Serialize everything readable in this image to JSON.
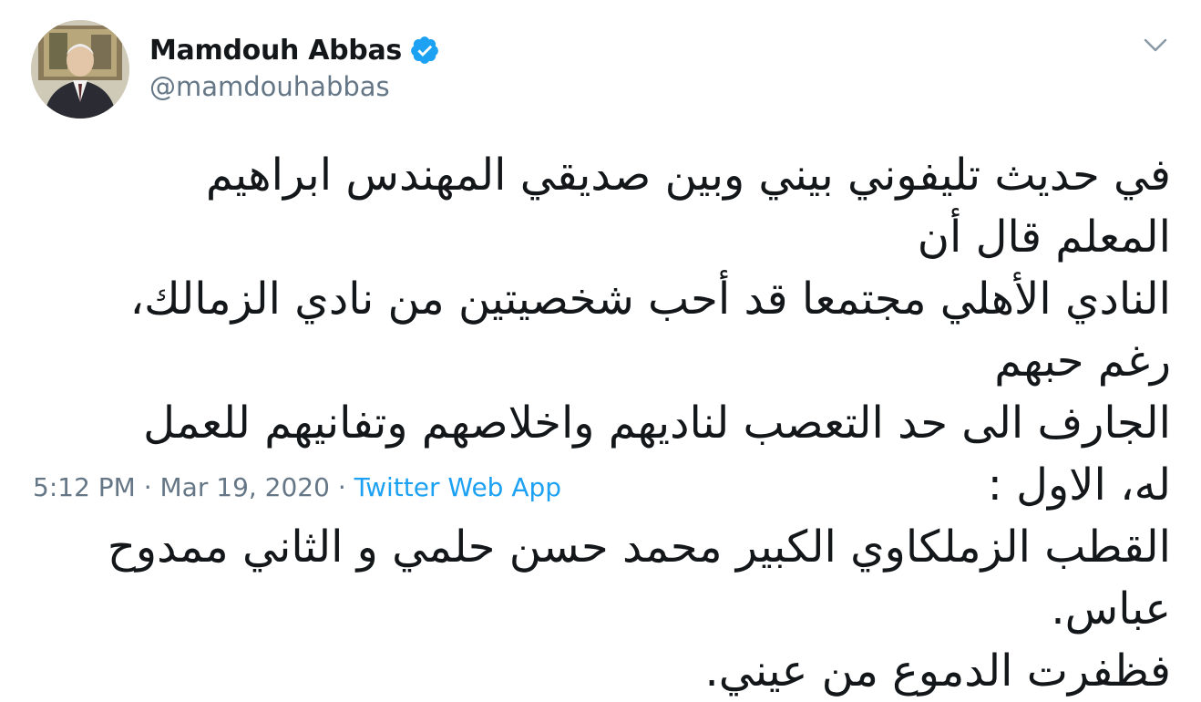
{
  "tweet": {
    "author": {
      "display_name": "Mamdouh Abbas",
      "handle": "@mamdouhabbas",
      "verified": true,
      "avatar_icon": "user-avatar"
    },
    "menu_icon": "chevron-down-icon",
    "text": "في حديث تليفوني بيني وبين صديقي المهندس ابراهيم المعلم قال أن\nالنادي الأهلي مجتمعا قد أحب شخصيتين من نادي الزمالك، رغم حبهم\nالجارف الى حد التعصب لناديهم واخلاصهم وتفانيهم للعمل له، الاول :\nالقطب الزملكاوي الكبير محمد حسن حلمي و الثاني ممدوح عباس.\nفظفرت الدموع من عيني.",
    "footer": {
      "time": "5:12 PM · Mar 19, 2020",
      "separator": "·",
      "source": "Twitter Web App"
    },
    "colors": {
      "verified_badge": "#1da1f2",
      "secondary_text": "#657786",
      "primary_text": "#14171a"
    }
  }
}
